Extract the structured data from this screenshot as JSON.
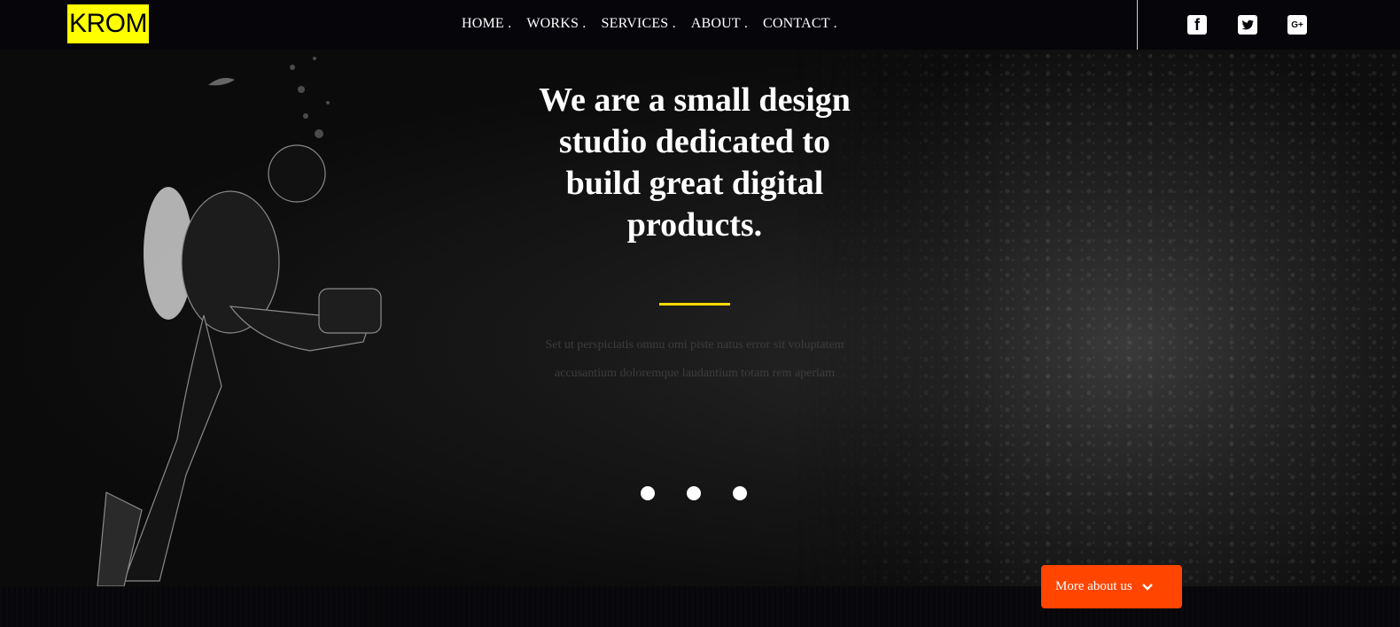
{
  "brand": {
    "logo_text": "KROM",
    "logo_bg": "#ffff00"
  },
  "nav": {
    "items": [
      {
        "label": "HOME ."
      },
      {
        "label": "WORKS ."
      },
      {
        "label": "SERVICES ."
      },
      {
        "label": "ABOUT ."
      },
      {
        "label": "CONTACT ."
      }
    ]
  },
  "social": {
    "facebook_icon": "f",
    "twitter_icon": "twitter-bird",
    "googleplus_icon": "G+"
  },
  "hero": {
    "headline": "We are a small design studio dedicated to build great digital products.",
    "subtext": "Set ut perspiciatis omnu omi piste natus error sit voluptatem accusantium doloremque laudantium totam rem aperiam",
    "accent_color": "#ffd900",
    "slides": 3
  },
  "cta": {
    "label": "More about us",
    "color": "#ff4500"
  }
}
